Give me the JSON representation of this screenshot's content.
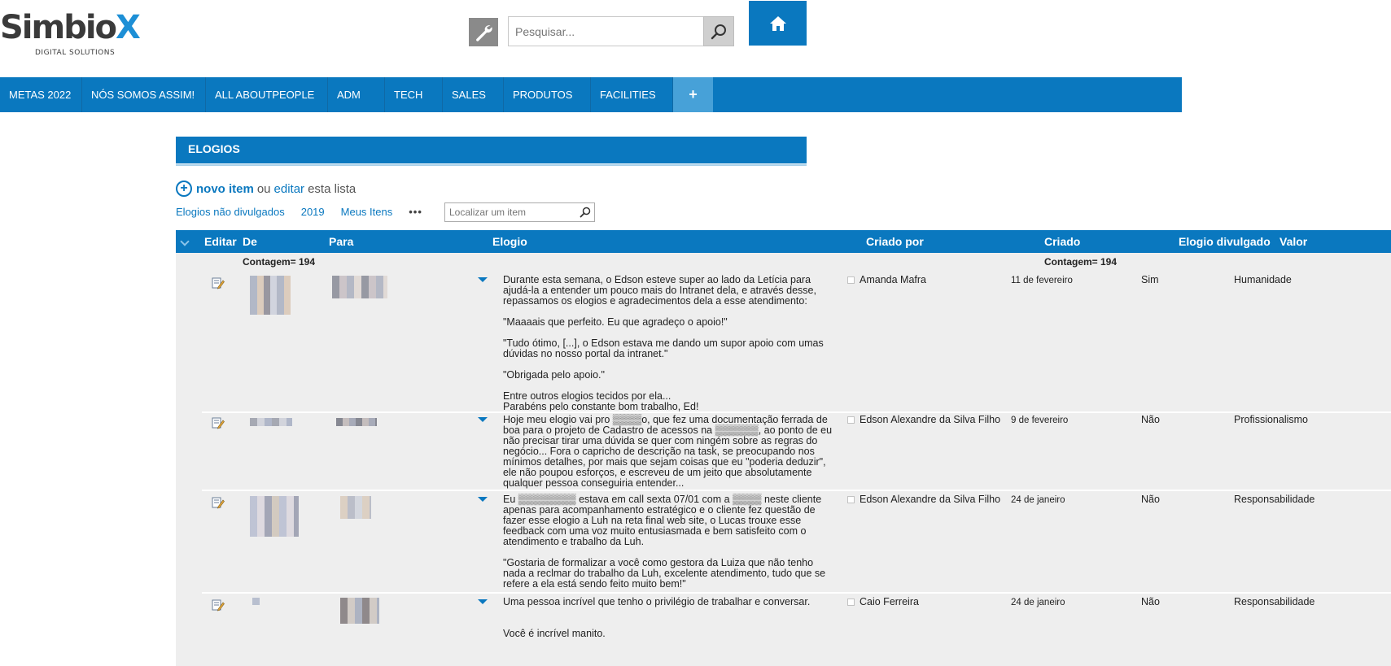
{
  "brand": {
    "logo_main": "Simbio",
    "logo_x": "X",
    "logo_sub": "DIGITAL SOLUTIONS"
  },
  "search": {
    "placeholder": "Pesquisar..."
  },
  "icons": {
    "tools": "wrench-icon",
    "search": "magnifier-icon",
    "home": "home-icon"
  },
  "nav": {
    "items": [
      "METAS 2022",
      "NÓS SOMOS ASSIM!",
      "ALL ABOUTPEOPLE",
      "ADM",
      "TECH",
      "SALES",
      "PRODUTOS",
      "FACILITIES"
    ],
    "plus_label": "+"
  },
  "list": {
    "title": "ELOGIOS",
    "new_item": "novo item",
    "or": "ou",
    "edit": "editar",
    "edit_suffix": "esta lista",
    "views": [
      "Elogios não divulgados",
      "2019",
      "Meus Itens"
    ],
    "more": "•••",
    "find_placeholder": "Localizar um item"
  },
  "table": {
    "columns": {
      "editar": "Editar",
      "de": "De",
      "para": "Para",
      "elogio": "Elogio",
      "criado_por": "Criado por",
      "criado": "Criado",
      "divulgado": "Elogio divulgado",
      "valor": "Valor"
    },
    "count_de": "Contagem= 194",
    "count_criado": "Contagem= 194",
    "rows": [
      {
        "elogio": [
          "Durante esta semana, o Edson esteve super ao lado da Letícia para ajudá-la a entender um pouco mais do Intranet dela, e através desse, repassamos os elogios e agradecimentos dela a esse atendimento:",
          "\"Maaaais que perfeito. Eu que agradeço o apoio!\"",
          "\"Tudo ótimo, [...], o Edson estava me dando um supor apoio com umas dúvidas no nosso portal da intranet.\"",
          "\"Obrigada pelo apoio.\"",
          "Entre outros elogios tecidos por ela...\nParabéns pelo constante bom trabalho, Ed!"
        ],
        "criado_por": "Amanda Mafra",
        "criado": "11 de fevereiro",
        "divulgado": "Sim",
        "valor": "Humanidade"
      },
      {
        "elogio": [
          "Hoje meu elogio vai pro ▒▒▒▒o, que fez uma documentação ferrada de boa para o projeto de Cadastro de acessos na ▒▒▒▒▒▒, ao ponto de eu não precisar tirar uma dúvida se quer com ningém sobre as regras do negócio... Fora o capricho de descrição na task, se preocupando nos mínimos detalhes, por mais que sejam coisas que eu \"poderia deduzir\", ele não poupou esforços, e escreveu de um jeito que absolutamente qualquer pessoa conseguiria entender..."
        ],
        "criado_por": "Edson Alexandre da Silva Filho",
        "criado": "9 de fevereiro",
        "divulgado": "Não",
        "valor": "Profissionalismo"
      },
      {
        "elogio": [
          "Eu ▒▒▒▒▒▒▒▒ estava em call sexta 07/01 com a ▒▒▒▒ neste cliente apenas para acompanhamento estratégico e o cliente fez questão de fazer esse elogio a Luh na reta final web site, o Lucas trouxe esse feedback com uma voz muito entusiasmada e bem satisfeito com o atendimento e trabalho da Luh.",
          "\"Gostaria de formalizar a você como gestora da Luiza que não tenho nada a reclmar do trabalho da Luh, excelente atendimento, tudo que se refere a ela está sendo feito muito bem!\""
        ],
        "criado_por": "Edson Alexandre da Silva Filho",
        "criado": "24 de janeiro",
        "divulgado": "Não",
        "valor": "Responsabilidade"
      },
      {
        "elogio": [
          "Uma pessoa incrível que tenho o privilégio de trabalhar e conversar.",
          "\nVocê é incrível manito."
        ],
        "criado_por": "Caio Ferreira",
        "criado": "24 de janeiro",
        "divulgado": "Não",
        "valor": "Responsabilidade"
      }
    ]
  },
  "colors": {
    "brand_blue": "#0a78bf",
    "nav_plus": "#47a1d8",
    "row_bg": "#eeeeee"
  }
}
